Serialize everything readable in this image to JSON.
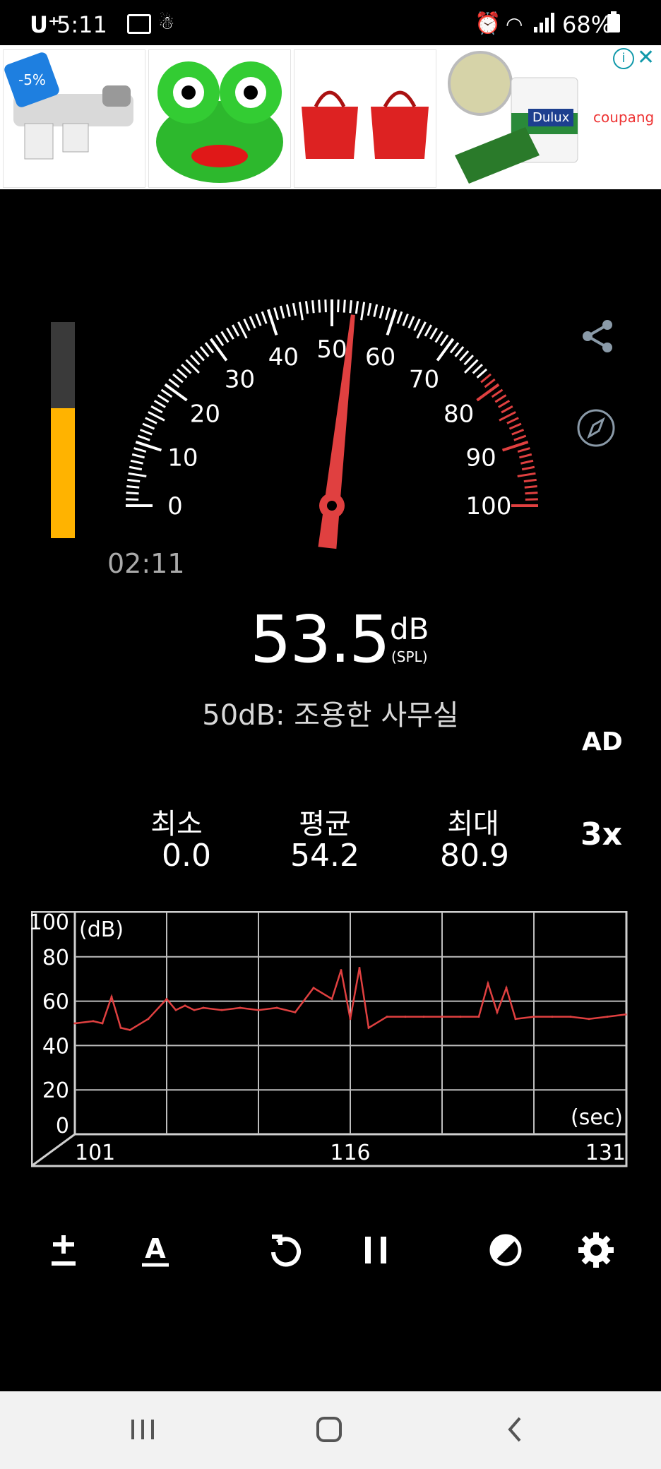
{
  "status_bar": {
    "carrier": "U⁺",
    "time": "5:11",
    "battery": "68%"
  },
  "ad": {
    "badge": "-5%",
    "brand_paint": "Dulux",
    "brand": "coupang",
    "info_icon": "info-icon",
    "close_icon": "close-icon"
  },
  "level_bar": {
    "fill_fraction": 0.6,
    "color": "#ffb300"
  },
  "gauge": {
    "min": 0,
    "max": 100,
    "value": 53.5,
    "labels": [
      "0",
      "10",
      "20",
      "30",
      "40",
      "50",
      "60",
      "70",
      "80",
      "90",
      "100"
    ],
    "elapsed": "02:11",
    "red_zone_from": 78
  },
  "reading": {
    "value": "53.5",
    "unit": "dB",
    "unit_sub": "(SPL)",
    "description": "50dB: 조용한 사무실"
  },
  "ad_label": "AD",
  "stats": {
    "min_label": "최소",
    "min_value": "0.0",
    "avg_label": "평균",
    "avg_value": "54.2",
    "max_label": "최대",
    "max_value": "80.9"
  },
  "zoom": "3x",
  "chart_data": {
    "type": "line",
    "ylabel": "(dB)",
    "xlabel": "(sec)",
    "ylim": [
      0,
      100
    ],
    "xlim": [
      101,
      131
    ],
    "y_ticks": [
      "0",
      "20",
      "40",
      "60",
      "80",
      "100"
    ],
    "x_ticks": [
      "101",
      "116",
      "131"
    ],
    "grid": true,
    "color": "#e04040",
    "x": [
      101,
      102,
      102.5,
      103,
      103.5,
      104,
      105,
      106,
      106.5,
      107,
      107.5,
      108,
      109,
      110,
      111,
      112,
      113,
      114,
      115,
      115.5,
      116,
      116.5,
      117,
      118,
      119,
      120,
      121,
      122,
      123,
      123.5,
      124,
      124.5,
      125,
      126,
      127,
      128,
      129,
      130,
      131
    ],
    "y": [
      50,
      51,
      50,
      62,
      48,
      47,
      52,
      61,
      56,
      58,
      56,
      57,
      56,
      57,
      56,
      57,
      55,
      66,
      61,
      74,
      52,
      75,
      48,
      53,
      53,
      53,
      53,
      53,
      53,
      68,
      55,
      66,
      52,
      53,
      53,
      53,
      52,
      53,
      54
    ]
  },
  "toolbar": {
    "calibrate_icon": "plus-minus-icon",
    "weighting_icon": "a-weighting-icon",
    "reset_icon": "reset-icon",
    "pause_icon": "pause-icon",
    "theme_icon": "contrast-icon",
    "settings_icon": "gear-icon"
  }
}
